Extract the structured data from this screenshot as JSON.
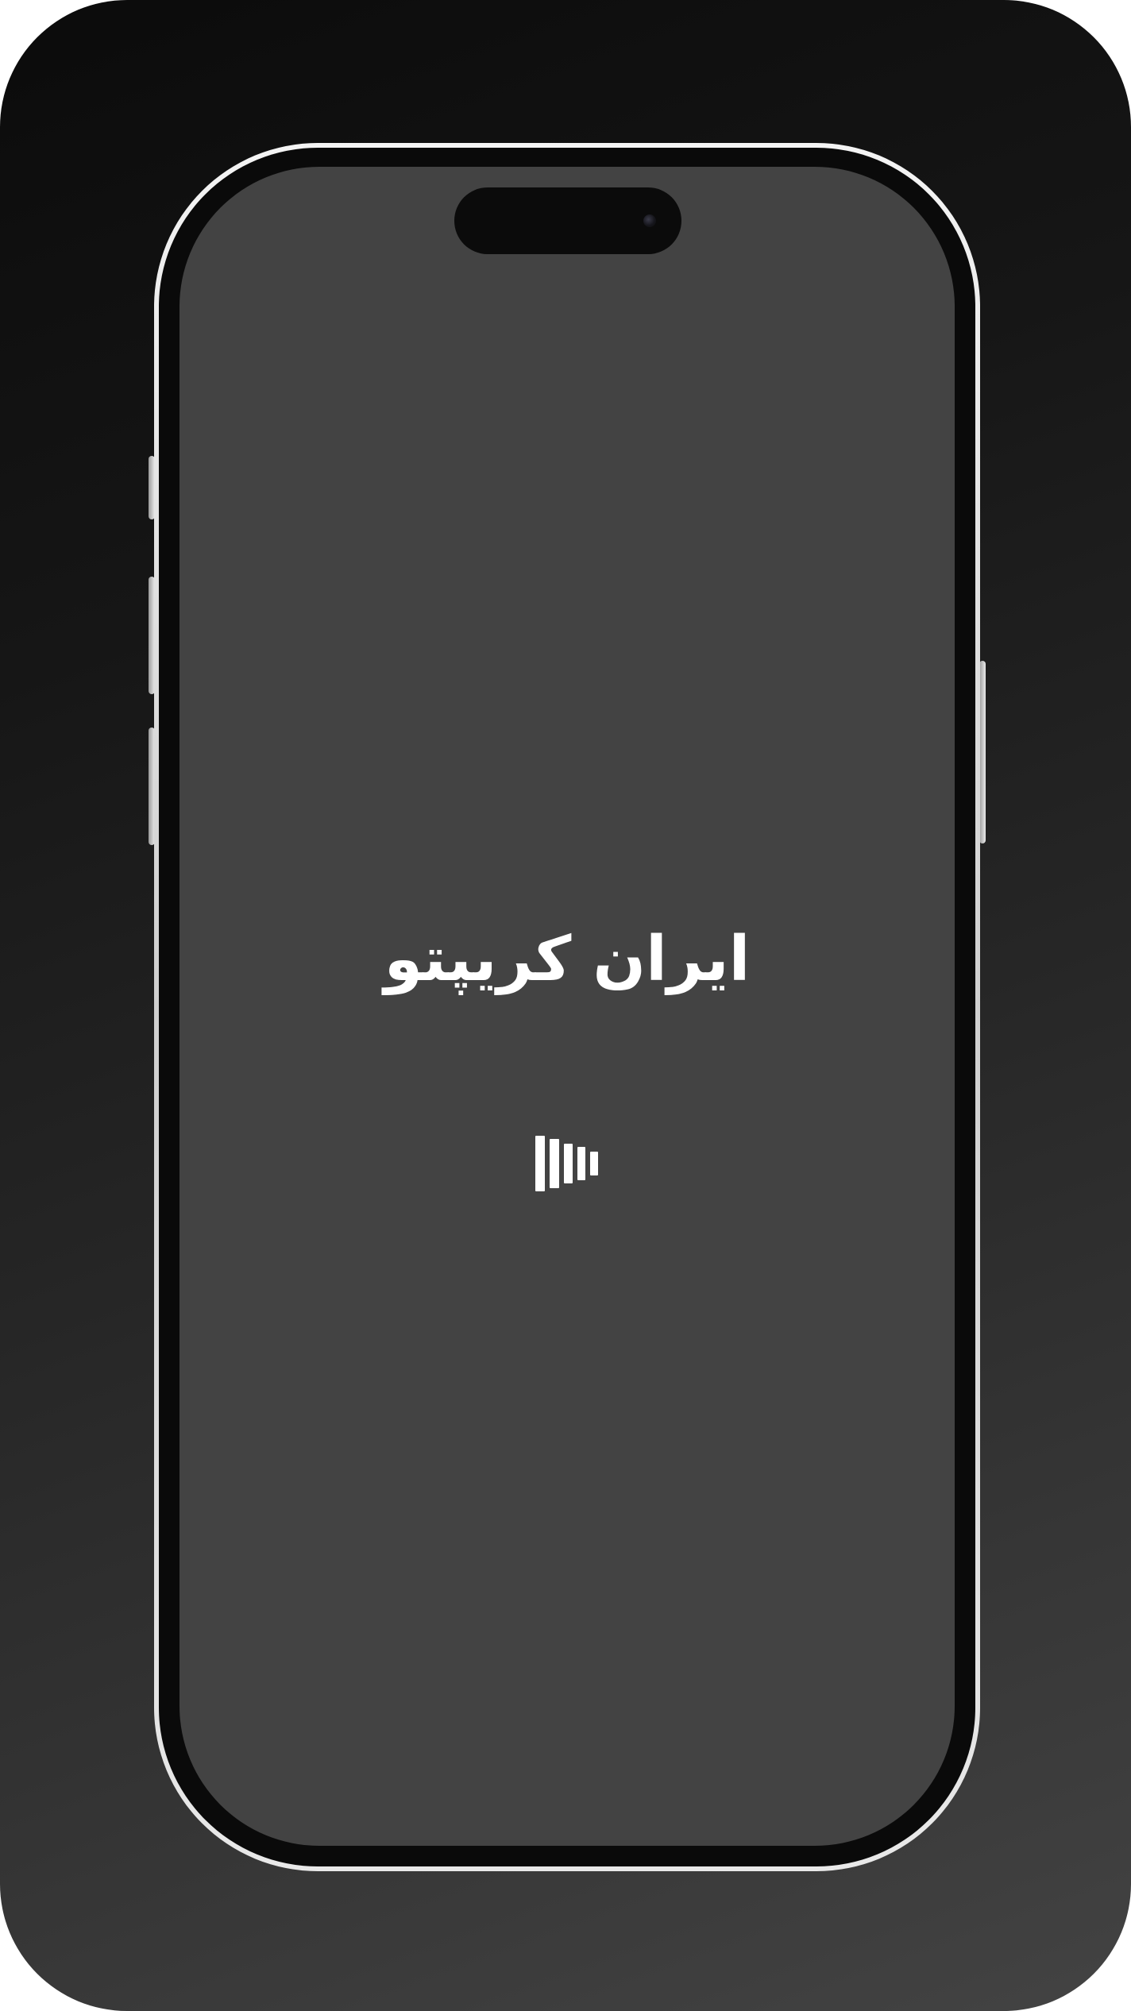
{
  "splash": {
    "brand_title": "ایران کریپتو",
    "loader_icon": "loading-bars-icon"
  },
  "colors": {
    "screen_background": "#434343",
    "title_text": "#ffffff",
    "device_frame": "#0a0a0a"
  }
}
